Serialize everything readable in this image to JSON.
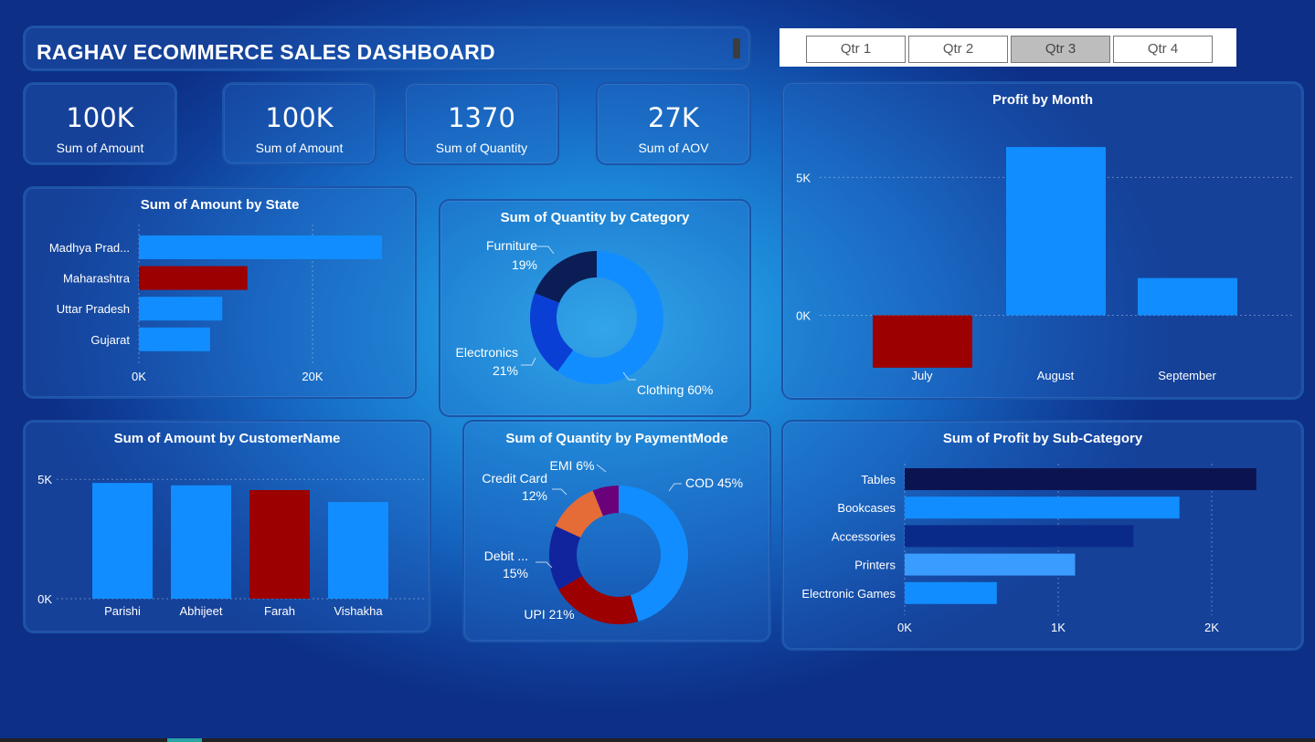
{
  "dashboard": {
    "title": "RAGHAV ECOMMERCE SALES DASHBOARD",
    "slicer": {
      "options": [
        "Qtr 1",
        "Qtr 2",
        "Qtr 3",
        "Qtr 4"
      ],
      "selected": "Qtr 3"
    },
    "kpis": [
      {
        "value": "100K",
        "label": "Sum of Amount"
      },
      {
        "value": "100K",
        "label": "Sum of Amount"
      },
      {
        "value": "1370",
        "label": "Sum of Quantity"
      },
      {
        "value": "27K",
        "label": "Sum of AOV"
      }
    ],
    "colors": {
      "blue": "#118dff",
      "red": "#9c0000",
      "navy": "#12239e",
      "darknavy": "#0b1450",
      "orange": "#e66c37",
      "purple": "#6b007b",
      "lightblue": "#3b9cff",
      "deepblue": "#0a2a8a"
    }
  },
  "chart_data": [
    {
      "id": "state",
      "type": "bar",
      "orientation": "horizontal",
      "title": "Sum of Amount by State",
      "categories": [
        "Madhya Prad...",
        "Maharashtra",
        "Uttar Pradesh",
        "Gujarat"
      ],
      "values": [
        28000,
        12500,
        9600,
        8200
      ],
      "xticks": [
        "0K",
        "20K"
      ],
      "xlim": [
        0,
        30000
      ],
      "highlight": "Maharashtra"
    },
    {
      "id": "category",
      "type": "pie",
      "donut": true,
      "title": "Sum of Quantity by Category",
      "slices": [
        {
          "label": "Clothing",
          "pct": "60%",
          "value": 60,
          "color": "#118dff"
        },
        {
          "label": "Electronics",
          "pct": "21%",
          "value": 21,
          "color": "#0a3fd6"
        },
        {
          "label": "Furniture",
          "pct": "19%",
          "value": 19,
          "color": "#0b1d55"
        }
      ],
      "labels": [
        "Furniture",
        "19%",
        "Electronics",
        "21%",
        "Clothing 60%"
      ]
    },
    {
      "id": "month",
      "type": "bar",
      "title": "Profit by Month",
      "categories": [
        "July",
        "August",
        "September"
      ],
      "values": [
        -1900,
        6100,
        1350
      ],
      "yticks": [
        "5K",
        "0K"
      ],
      "ylim": [
        -2500,
        6500
      ]
    },
    {
      "id": "customer",
      "type": "bar",
      "title": "Sum of Amount by CustomerName",
      "categories": [
        "Parishi",
        "Abhijeet",
        "Farah",
        "Vishakha"
      ],
      "values": [
        4850,
        4750,
        4550,
        4050
      ],
      "yticks": [
        "5K",
        "0K"
      ],
      "ylim": [
        0,
        5200
      ],
      "highlight": "Farah"
    },
    {
      "id": "payment",
      "type": "pie",
      "donut": true,
      "title": "Sum of Quantity by PaymentMode",
      "slices": [
        {
          "label": "COD",
          "pct": "45%",
          "value": 45,
          "color": "#118dff"
        },
        {
          "label": "UPI",
          "pct": "21%",
          "value": 21,
          "color": "#9c0000"
        },
        {
          "label": "Debit ...",
          "pct": "15%",
          "value": 15,
          "color": "#12239e"
        },
        {
          "label": "Credit Card",
          "pct": "12%",
          "value": 12,
          "color": "#e66c37"
        },
        {
          "label": "EMI",
          "pct": "6%",
          "value": 6,
          "color": "#6b007b"
        }
      ],
      "labels": [
        "EMI 6%",
        "Credit Card",
        "12%",
        "COD 45%",
        "Debit ...",
        "15%",
        "UPI 21%"
      ]
    },
    {
      "id": "subcat",
      "type": "bar",
      "orientation": "horizontal",
      "title": "Sum of Profit by Sub-Category",
      "categories": [
        "Tables",
        "Bookcases",
        "Accessories",
        "Printers",
        "Electronic Games"
      ],
      "values": [
        2290,
        1790,
        1490,
        1110,
        600
      ],
      "xticks": [
        "0K",
        "1K",
        "2K"
      ],
      "xlim": [
        0,
        2500
      ]
    }
  ]
}
